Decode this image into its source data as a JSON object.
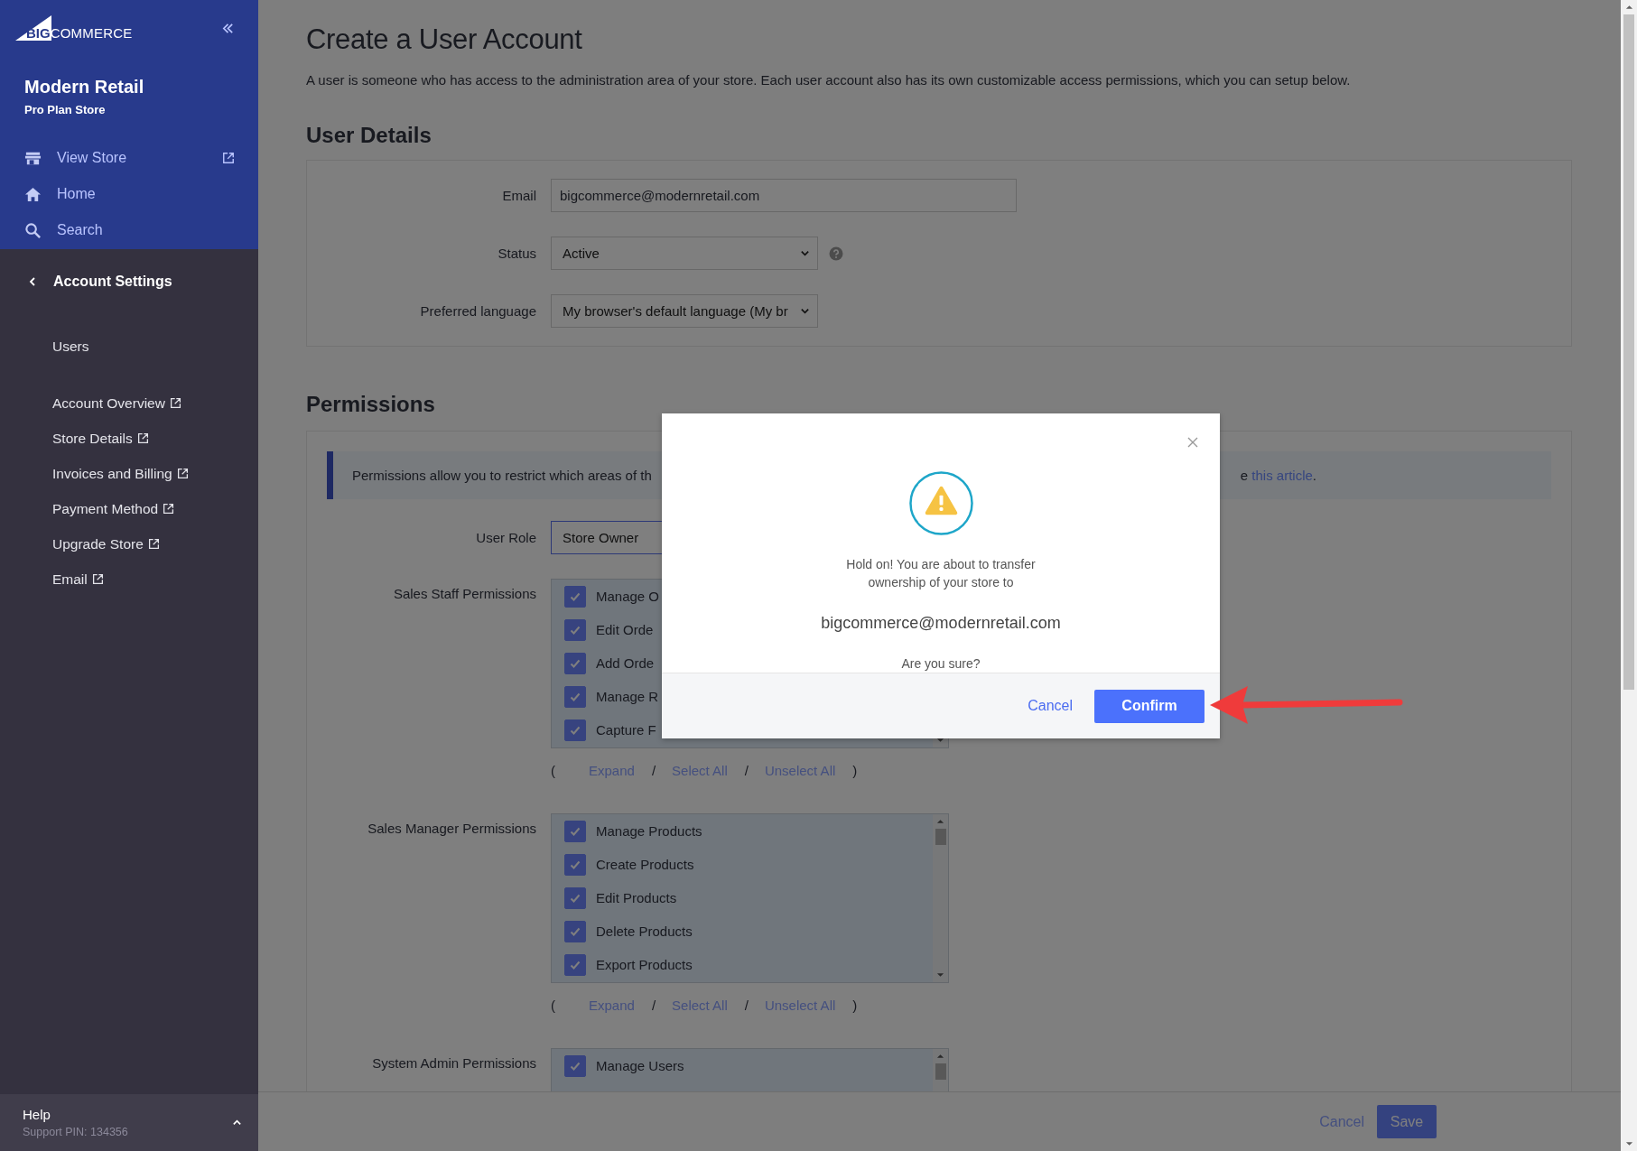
{
  "sidebar": {
    "logo": [
      "BIG",
      "COMMERCE"
    ],
    "store_name": "Modern Retail",
    "store_plan": "Pro Plan Store",
    "top_links": [
      {
        "label": "View Store",
        "external": true
      },
      {
        "label": "Home",
        "external": false
      },
      {
        "label": "Search",
        "external": false
      }
    ],
    "section": "Account Settings",
    "items": [
      {
        "label": "Users",
        "external": false
      },
      {
        "label": "Account Overview",
        "external": true
      },
      {
        "label": "Store Details",
        "external": true
      },
      {
        "label": "Invoices and Billing",
        "external": true
      },
      {
        "label": "Payment Method",
        "external": true
      },
      {
        "label": "Upgrade Store",
        "external": true
      },
      {
        "label": "Email",
        "external": true
      }
    ],
    "help": {
      "title": "Help",
      "support_pin": "Support PIN: 134356"
    }
  },
  "page": {
    "title": "Create a User Account",
    "description": "A user is someone who has access to the administration area of your store. Each user account also has its own customizable access permissions, which you can setup below.",
    "user_details": {
      "heading": "User Details",
      "fields": [
        {
          "label": "Email",
          "kind": "input",
          "value": "bigcommerce@modernretail.com",
          "help": false
        },
        {
          "label": "Status",
          "kind": "select",
          "value": "Active",
          "help": true
        },
        {
          "label": "Preferred language",
          "kind": "select",
          "value": "My browser's default language (My br",
          "help": false
        }
      ]
    },
    "permissions": {
      "heading": "Permissions",
      "banner": {
        "text_left": "Permissions allow you to restrict which areas of th",
        "text_right": "e",
        "link": "this article",
        "text_end": "."
      },
      "user_role": {
        "label": "User Role",
        "value": "Store Owner"
      },
      "groups": [
        {
          "label": "Sales Staff Permissions",
          "items": [
            {
              "label": "Manage O",
              "checked": true
            },
            {
              "label": "Edit Orde",
              "checked": true
            },
            {
              "label": "Add Orde",
              "checked": true
            },
            {
              "label": "Manage R",
              "checked": true
            },
            {
              "label": "Capture F",
              "checked": true
            }
          ],
          "actions": {
            "open": "(",
            "separator": "/",
            "close": ")",
            "links": [
              "Expand",
              "Select All",
              "Unselect All"
            ]
          }
        },
        {
          "label": "Sales Manager Permissions",
          "items": [
            {
              "label": "Manage Products",
              "checked": true
            },
            {
              "label": "Create Products",
              "checked": true
            },
            {
              "label": "Edit Products",
              "checked": true
            },
            {
              "label": "Delete Products",
              "checked": true
            },
            {
              "label": "Export Products",
              "checked": true
            }
          ],
          "actions": {
            "open": "(",
            "separator": "/",
            "close": ")",
            "links": [
              "Expand",
              "Select All",
              "Unselect All"
            ]
          }
        },
        {
          "label": "System Admin Permissions",
          "items": [
            {
              "label": "Manage Users",
              "checked": true
            }
          ]
        }
      ]
    }
  },
  "footer_bar": {
    "cancel": "Cancel",
    "save": "Save"
  },
  "dialog": {
    "message": "Hold on! You are about to transfer ownership of your store to",
    "email": "bigcommerce@modernretail.com",
    "question": "Are you sure?",
    "cancel": "Cancel",
    "confirm": "Confirm"
  }
}
